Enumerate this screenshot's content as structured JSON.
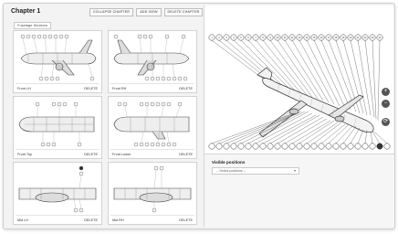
{
  "header": {
    "chapter_title": "Chapter 1",
    "collapse_label": "COLLAPSE CHAPTER",
    "add_view_label": "ADD VIEW",
    "delete_chapter_label": "DELETE CHAPTER"
  },
  "group": {
    "label": "Fuselage Sections"
  },
  "cards": [
    {
      "label": "Front LH",
      "delete": "DELETE"
    },
    {
      "label": "Front RH",
      "delete": "DELETE"
    },
    {
      "label": "Front Top",
      "delete": "DELETE"
    },
    {
      "label": "Front Lower",
      "delete": "DELETE"
    },
    {
      "label": "Mid LH",
      "delete": "DELETE"
    },
    {
      "label": "Mid RH",
      "delete": "DELETE"
    }
  ],
  "visible_positions": {
    "title": "Visible positions",
    "placeholder": "-- Select positions --"
  },
  "side_controls": {
    "zoom_in": "+",
    "zoom_out": "−",
    "rotate": "⟳"
  }
}
